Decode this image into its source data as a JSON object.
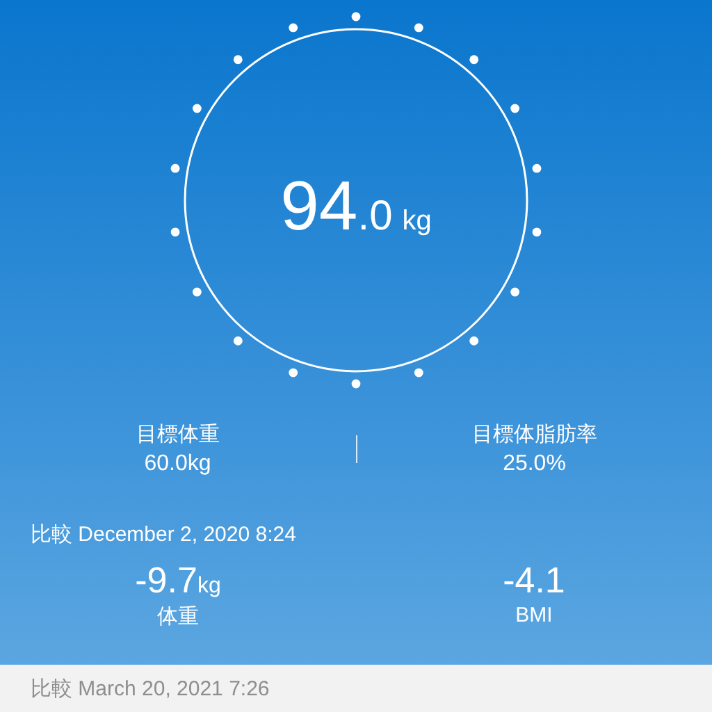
{
  "weight": {
    "integer": "94",
    "decimal": ".0",
    "unit": "kg"
  },
  "goals": [
    {
      "label": "目標体重",
      "value": "60.0kg"
    },
    {
      "label": "目標体脂肪率",
      "value": "25.0%"
    }
  ],
  "comparison": {
    "title": "比較 December 2, 2020 8:24",
    "deltas": [
      {
        "value": "-9.7",
        "unit": "kg",
        "label": "体重"
      },
      {
        "value": "-4.1",
        "label": "BMI"
      }
    ]
  },
  "footer": {
    "text": "比較 March 20, 2021 7:26"
  }
}
